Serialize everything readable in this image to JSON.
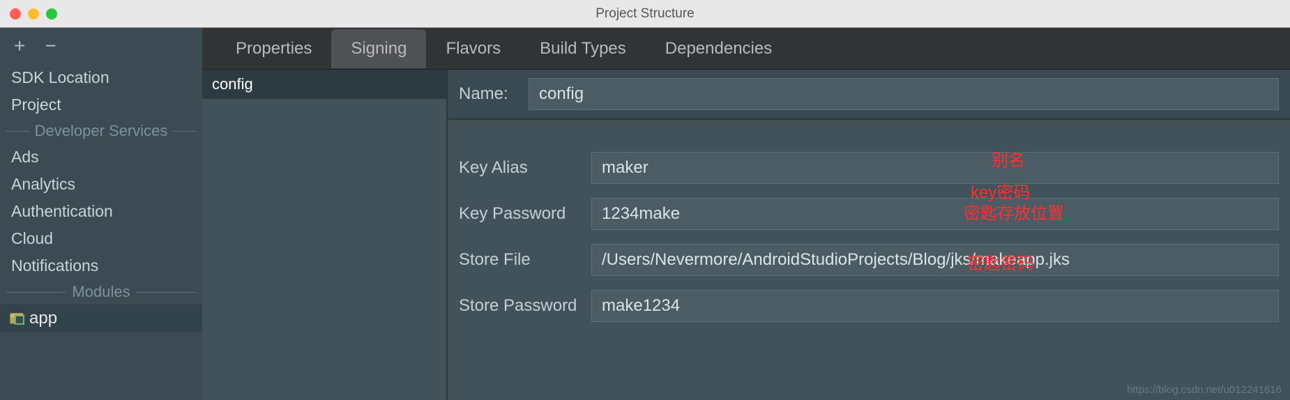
{
  "window": {
    "title": "Project Structure"
  },
  "sidebar": {
    "items_top": [
      "SDK Location",
      "Project"
    ],
    "section_dev": "Developer Services",
    "items_dev": [
      "Ads",
      "Analytics",
      "Authentication",
      "Cloud",
      "Notifications"
    ],
    "section_modules": "Modules",
    "module": "app"
  },
  "tabs": {
    "properties": "Properties",
    "signing": "Signing",
    "flavors": "Flavors",
    "build_types": "Build Types",
    "dependencies": "Dependencies"
  },
  "configs": {
    "selected": "config"
  },
  "form": {
    "name_label": "Name:",
    "name_value": "config",
    "key_alias_label": "Key Alias",
    "key_alias_value": "maker",
    "key_password_label": "Key Password",
    "key_password_value": "1234make",
    "store_file_label": "Store File",
    "store_file_value": "/Users/Nevermore/AndroidStudioProjects/Blog/jks/makeapp.jks",
    "store_password_label": "Store Password",
    "store_password_value": "make1234"
  },
  "annotations": {
    "alias": "别名",
    "key_pw": "key密码",
    "store_loc": "密匙存放位置",
    "store_pw": "密匙密码"
  },
  "watermark": "https://blog.csdn.net/u012241616",
  "icons": {
    "plus": "+",
    "minus": "−"
  }
}
